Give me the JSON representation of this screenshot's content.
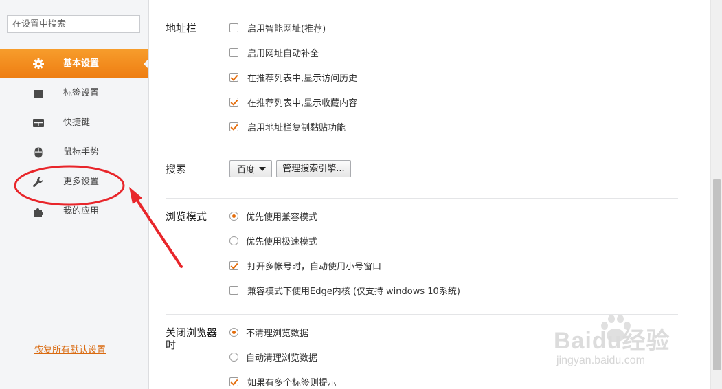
{
  "sidebar": {
    "search_placeholder": "在设置中搜索",
    "items": [
      {
        "label": "基本设置",
        "icon": "gear-icon",
        "active": true
      },
      {
        "label": "标签设置",
        "icon": "tab-icon",
        "active": false
      },
      {
        "label": "快捷键",
        "icon": "keyboard-icon",
        "active": false
      },
      {
        "label": "鼠标手势",
        "icon": "mouse-icon",
        "active": false
      },
      {
        "label": "更多设置",
        "icon": "wrench-icon",
        "active": false
      },
      {
        "label": "我的应用",
        "icon": "puzzle-icon",
        "active": false
      }
    ],
    "restore_defaults": "恢复所有默认设置"
  },
  "address_bar": {
    "title": "地址栏",
    "options": [
      {
        "label": "启用智能网址(推荐)",
        "checked": false
      },
      {
        "label": "启用网址自动补全",
        "checked": false
      },
      {
        "label": "在推荐列表中,显示访问历史",
        "checked": true
      },
      {
        "label": "在推荐列表中,显示收藏内容",
        "checked": true
      },
      {
        "label": "启用地址栏复制黏贴功能",
        "checked": true
      }
    ]
  },
  "search": {
    "title": "搜索",
    "engine_selected": "百度",
    "manage_button": "管理搜索引擎..."
  },
  "browse_mode": {
    "title": "浏览模式",
    "radio_compat": "优先使用兼容模式",
    "radio_speed": "优先使用极速模式",
    "selected": "compat",
    "multi_account": {
      "label": "打开多帐号时，自动使用小号窗口",
      "checked": true
    },
    "edge_core": {
      "label": "兼容模式下使用Edge内核 (仅支持 windows 10系统)",
      "checked": false
    }
  },
  "on_close": {
    "title": "关闭浏览器时",
    "radio_keep": "不清理浏览数据",
    "radio_clear": "自动清理浏览数据",
    "selected": "keep",
    "multi_tab_prompt": {
      "label": "如果有多个标签则提示",
      "checked": true
    }
  },
  "watermark": {
    "brand": "Baidu经验",
    "domain": "jingyan.baidu.com"
  },
  "colors": {
    "accent": "#ee7d12",
    "annotation": "#e8262b",
    "check": "#e46c0a"
  }
}
